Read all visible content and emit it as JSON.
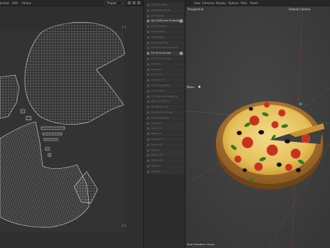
{
  "uv_editor": {
    "menu": [
      "jection",
      "Edit",
      "Failure"
    ],
    "projection_select": "Project",
    "marks": {
      "top_right": "1.1",
      "bottom_right": "1.0"
    }
  },
  "tools": {
    "items": [
      {
        "label": "Edit UV Point",
        "active": false
      },
      {
        "label": "Projection Mode",
        "active": false
      },
      {
        "label": "UV Display",
        "active": false
      },
      {
        "label": "Set UVW From Projection",
        "active": true,
        "option": true
      },
      {
        "label": "UV Projection",
        "active": false
      },
      {
        "label": "Frontal Map",
        "active": false
      },
      {
        "label": "Cubic Map",
        "active": false
      },
      {
        "label": "Spherical Map",
        "active": false
      },
      {
        "label": "Set Uvw from Camera",
        "active": false
      },
      {
        "label": "Fit UV to Canvas",
        "active": true,
        "option": true
      },
      {
        "label": "Fit UV to Canvas",
        "active": false
      },
      {
        "label": "UV Pack",
        "active": false
      },
      {
        "label": "Relax UV",
        "active": false
      },
      {
        "label": "Scale UV",
        "active": false
      },
      {
        "label": "Unwrap UV",
        "active": false
      },
      {
        "label": "UV Manipulator",
        "active": false
      },
      {
        "label": "UV Packing",
        "active": false
      },
      {
        "label": "UV Optimize Mapping",
        "active": false
      },
      {
        "label": "Align UV Points",
        "active": false
      },
      {
        "label": "Straighten UV",
        "active": false
      },
      {
        "label": "Equalize UV Scale",
        "active": false
      },
      {
        "label": "Rectangularize",
        "active": false
      },
      {
        "label": "Align UV",
        "active": false
      },
      {
        "label": "Snap UV",
        "active": false
      },
      {
        "label": "Weld UV",
        "active": false
      },
      {
        "label": "Unweld UV",
        "active": false
      },
      {
        "label": "Mirror UV",
        "active": false
      },
      {
        "label": "Flip UV",
        "active": false
      },
      {
        "label": "Rotate UV",
        "active": false
      },
      {
        "label": "Stitch UV",
        "active": false
      },
      {
        "label": "Sew UV",
        "active": false
      },
      {
        "label": "Overlap",
        "active": false
      }
    ]
  },
  "viewport": {
    "menu": [
      "View",
      "Cameras",
      "Display",
      "Options",
      "Filter",
      "Panel"
    ],
    "view_name": "Perspective",
    "camera": "Default Camera",
    "move_label": "Move",
    "footer": "View Transform: Scene"
  },
  "colors": {
    "accent": "#4a7fb5",
    "crust": "#b07a35",
    "cheese": "#e8c867",
    "tomato": "#c8321c",
    "olive": "#161616",
    "basil": "#2f7d1e"
  }
}
